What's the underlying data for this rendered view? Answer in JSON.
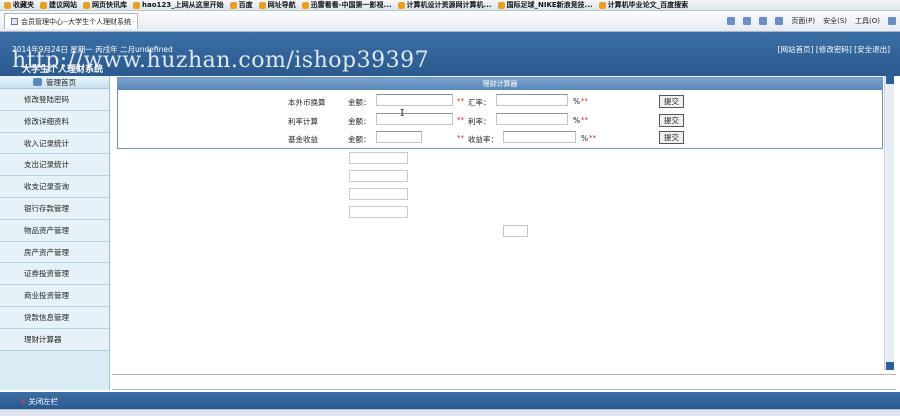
{
  "browser": {
    "favorites": [
      "收藏夹",
      "建议网站",
      "网页快讯库",
      "hao123_上网从这里开始",
      "百度",
      "网址导航",
      "迅雷看看-中国第一影视...",
      "计算机设计资源网计算机...",
      "国际足球_NIKE新浪竞技...",
      "计算机毕业论文_百度搜索"
    ],
    "tab_title": "会员管理中心--大学生个人理财系统",
    "tools": [
      "页面(P)",
      "安全(S)",
      "工具(O)"
    ]
  },
  "header": {
    "date": "2014年9月24日 星期一 丙戌年 二月undefined",
    "links": "[网站首页] [修改密码] [安全退出]",
    "system_name": "大学生个人理财系统",
    "watermark": "http://www.huzhan.com/ishop39397"
  },
  "sidebar": {
    "head": "管理首页",
    "items": [
      {
        "label": "修改登陆密码"
      },
      {
        "label": "修改详细资料"
      },
      {
        "label": "收入记录统计"
      },
      {
        "label": "支出记录统计"
      },
      {
        "label": "收支记录查询"
      },
      {
        "label": "银行存款管理"
      },
      {
        "label": "物品资产管理"
      },
      {
        "label": "房产资产管理"
      },
      {
        "label": "证券投资管理"
      },
      {
        "label": "商业投资管理"
      },
      {
        "label": "贷款信息管理"
      },
      {
        "label": "理财计算器"
      }
    ]
  },
  "calculator": {
    "title": "理财计算器",
    "rows": [
      {
        "label": "本外币换算",
        "amount_label": "金额：",
        "second_label": "汇率：",
        "unit": "%",
        "button": "提交",
        "amount_value": "",
        "second_value": ""
      },
      {
        "label": "利率计算",
        "amount_label": "金额：",
        "second_label": "利率：",
        "unit": "%",
        "button": "提交",
        "amount_value": "",
        "second_value": ""
      },
      {
        "label": "基金收益",
        "amount_label": "金额：",
        "second_label": "收益率：",
        "unit": "%",
        "button": "提交",
        "amount_value": "",
        "second_value": ""
      }
    ],
    "required_mark": "**"
  },
  "footer": {
    "close_label": "关闭左栏"
  }
}
